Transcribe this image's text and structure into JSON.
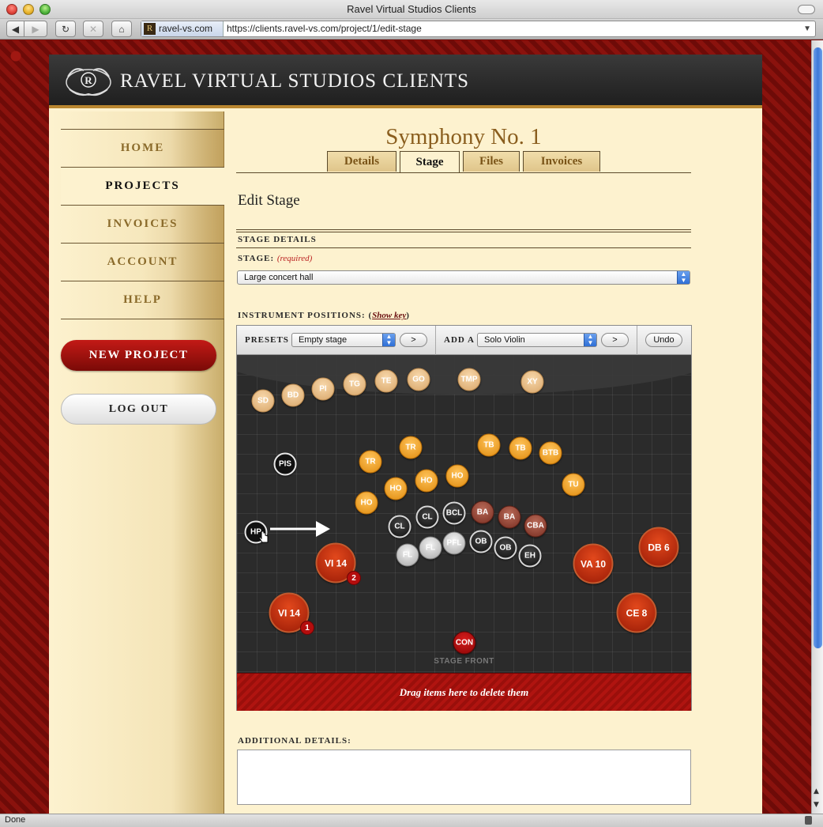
{
  "browser": {
    "window_title": "Ravel Virtual Studios Clients",
    "site_label": "ravel-vs.com",
    "url": "https://clients.ravel-vs.com/project/1/edit-stage",
    "status": "Done",
    "buttons": {
      "back": "◀",
      "forward": "▶",
      "reload": "↻",
      "stop": "✕",
      "home": "⌂"
    }
  },
  "header": {
    "brand": "RAVEL VIRTUAL STUDIOS CLIENTS",
    "logo_letter": "R"
  },
  "sidebar": {
    "items": [
      {
        "label": "HOME",
        "active": false
      },
      {
        "label": "PROJECTS",
        "active": true
      },
      {
        "label": "INVOICES",
        "active": false
      },
      {
        "label": "ACCOUNT",
        "active": false
      },
      {
        "label": "HELP",
        "active": false
      }
    ],
    "new_project": "NEW PROJECT",
    "log_out": "LOG OUT"
  },
  "main": {
    "title": "Symphony No. 1",
    "tabs": [
      {
        "label": "Details",
        "active": false
      },
      {
        "label": "Stage",
        "active": true
      },
      {
        "label": "Files",
        "active": false
      },
      {
        "label": "Invoices",
        "active": false
      }
    ],
    "section_heading": "Edit Stage",
    "stage_details": "STAGE DETAILS",
    "stage_label": "STAGE:",
    "required": "(required)",
    "stage_value": "Large concert hall",
    "positions_label": "INSTRUMENT POSITIONS:",
    "show_key": "Show key",
    "toolbar": {
      "presets_label": "PRESETS",
      "presets_value": "Empty stage",
      "go": ">",
      "add_label": "ADD A",
      "add_value": "Solo Violin",
      "undo": "Undo"
    },
    "stage_front": "STAGE FRONT",
    "delete_zone": "Drag items here to delete them",
    "additional_details": "ADDITIONAL DETAILS:"
  },
  "instruments": [
    {
      "label": "SD",
      "type": "perc"
    },
    {
      "label": "BD",
      "type": "perc"
    },
    {
      "label": "PI",
      "type": "perc"
    },
    {
      "label": "TG",
      "type": "perc"
    },
    {
      "label": "TE",
      "type": "perc"
    },
    {
      "label": "GO",
      "type": "perc"
    },
    {
      "label": "TMP",
      "type": "perc"
    },
    {
      "label": "XY",
      "type": "perc"
    },
    {
      "label": "PIS",
      "type": "other"
    },
    {
      "label": "TR",
      "type": "brass"
    },
    {
      "label": "TR",
      "type": "brass"
    },
    {
      "label": "TB",
      "type": "brass"
    },
    {
      "label": "TB",
      "type": "brass"
    },
    {
      "label": "BTB",
      "type": "brass"
    },
    {
      "label": "TU",
      "type": "brass"
    },
    {
      "label": "HO",
      "type": "brass"
    },
    {
      "label": "HO",
      "type": "brass"
    },
    {
      "label": "HO",
      "type": "brass"
    },
    {
      "label": "HO",
      "type": "brass"
    },
    {
      "label": "BA",
      "type": "string"
    },
    {
      "label": "BA",
      "type": "string"
    },
    {
      "label": "CBA",
      "type": "string"
    },
    {
      "label": "CL",
      "type": "wood"
    },
    {
      "label": "CL",
      "type": "wood"
    },
    {
      "label": "BCL",
      "type": "wood"
    },
    {
      "label": "OB",
      "type": "wood"
    },
    {
      "label": "OB",
      "type": "wood"
    },
    {
      "label": "EH",
      "type": "wood"
    },
    {
      "label": "FL",
      "type": "flute"
    },
    {
      "label": "FL",
      "type": "flute"
    },
    {
      "label": "PFL",
      "type": "flute"
    },
    {
      "label": "HP",
      "type": "other"
    },
    {
      "label": "VI 14",
      "type": "big",
      "badge": "2"
    },
    {
      "label": "VI 14",
      "type": "big",
      "badge": "1"
    },
    {
      "label": "VA 10",
      "type": "big"
    },
    {
      "label": "DB 6",
      "type": "big"
    },
    {
      "label": "CE 8",
      "type": "big"
    },
    {
      "label": "CON",
      "type": "con"
    }
  ]
}
